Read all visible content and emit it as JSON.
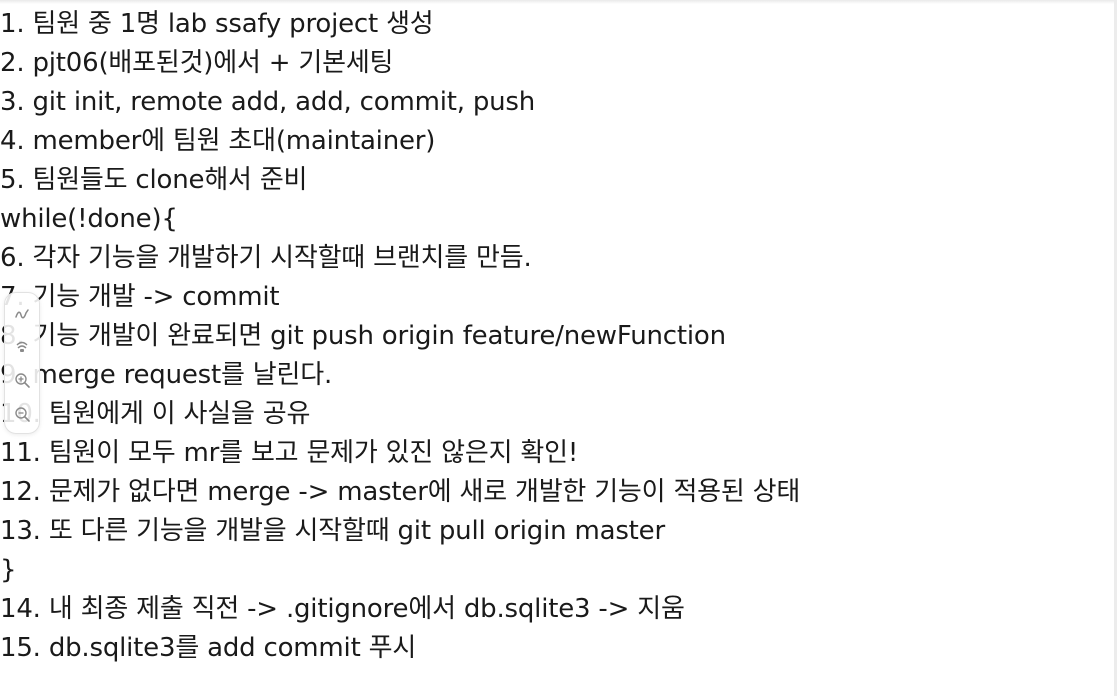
{
  "document": {
    "lines": [
      "1. 팀원 중 1명 lab ssafy project 생성",
      "2. pjt06(배포된것)에서 + 기본세팅",
      "3. git init, remote add, add, commit, push",
      "4. member에 팀원 초대(maintainer)",
      "5. 팀원들도 clone해서 준비",
      "while(!done){",
      "6. 각자 기능을 개발하기 시작할때 브랜치를 만듬.",
      "7. 기능 개발 -> commit",
      "8. 기능 개발이 완료되면 git push origin feature/newFunction",
      "9. merge request를 날린다.",
      "10. 팀원에게 이 사실을 공유",
      "11. 팀원이 모두 mr를 보고 문제가 있진 않은지 확인!",
      "12. 문제가 없다면 merge -> master에 새로 개발한 기능이 적용된 상태",
      "13. 또 다른 기능을 개발을 시작할때 git pull origin master",
      "}",
      "14. 내 최종 제출 직전 -> .gitignore에서 db.sqlite3 -> 지움",
      "15. db.sqlite3를 add commit 푸시"
    ]
  },
  "toolbar": {
    "tools": [
      "pen-icon",
      "highlighter-icon",
      "zoom-in-icon",
      "zoom-out-icon"
    ],
    "icon_color": "#8a8a8a"
  }
}
